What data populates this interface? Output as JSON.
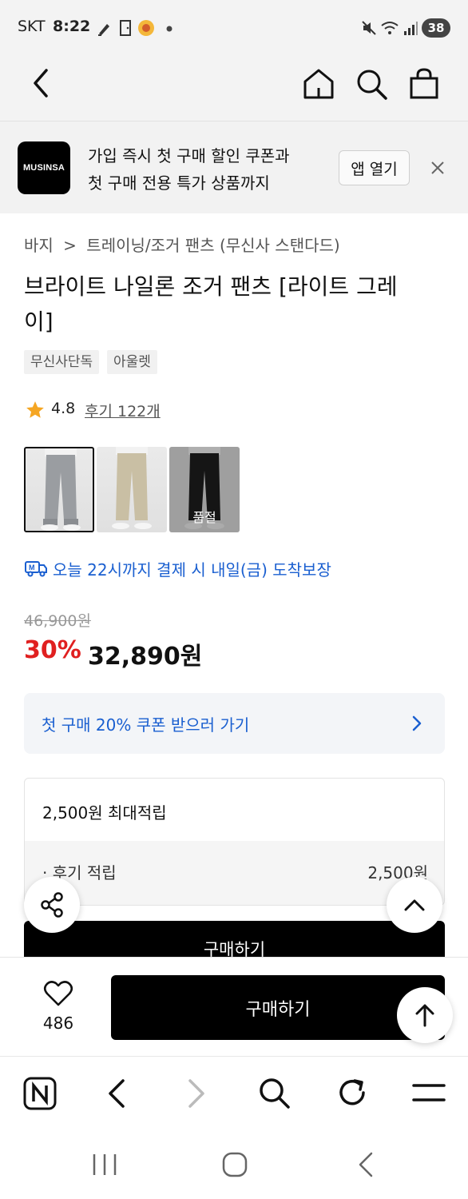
{
  "status_bar": {
    "carrier": "SKT",
    "time": "8:22",
    "battery": "38"
  },
  "header": {
    "icons": [
      "back-icon",
      "home-icon",
      "search-icon",
      "shopping-bag-icon"
    ]
  },
  "app_banner": {
    "logo_text": "MUSINSA",
    "line1": "가입 즉시 첫 구매 할인 쿠폰과",
    "line2": "첫 구매 전용 특가 상품까지",
    "open_button": "앱 열기"
  },
  "breadcrumb": {
    "category": "바지",
    "separator": ">",
    "subcategory": "트레이닝/조거 팬츠 (무신사 스탠다드)"
  },
  "product": {
    "title_line1": "브라이트 나일론 조거 팬츠 [라이트 그레",
    "title_line2": "이]",
    "tags": [
      "무신사단독",
      "아울렛"
    ],
    "rating": "4.8",
    "reviews_label": "후기 122개",
    "colors": [
      {
        "name": "light-gray",
        "selected": true,
        "pants_color": "#9a9da1",
        "soldout": false
      },
      {
        "name": "beige",
        "selected": false,
        "pants_color": "#c9bfa4",
        "soldout": false
      },
      {
        "name": "black",
        "selected": false,
        "pants_color": "#1c1c1c",
        "soldout": true
      }
    ],
    "soldout_label": "품절",
    "delivery": "오늘 22시까지 결제 시 내일(금) 도착보장",
    "original_price": "46,900원",
    "discount": "30%",
    "sale_price": "32,890원"
  },
  "coupon": {
    "label": "첫 구매 20% 쿠폰 받으러 가기"
  },
  "points": {
    "title": "2,500원 최대적립",
    "row_label": "· 후기 적립",
    "row_value": "2,500원"
  },
  "inline_buy_label": "구매하기",
  "bottom_bar": {
    "like_count": "486",
    "buy_label": "구매하기"
  },
  "browser_toolbar": {
    "icons": [
      "naver-icon",
      "back-icon",
      "forward-icon",
      "search-icon",
      "refresh-icon",
      "menu-icon"
    ]
  },
  "colors": {
    "accent_blue": "#1a5fd0",
    "discount_red": "#e02020"
  }
}
